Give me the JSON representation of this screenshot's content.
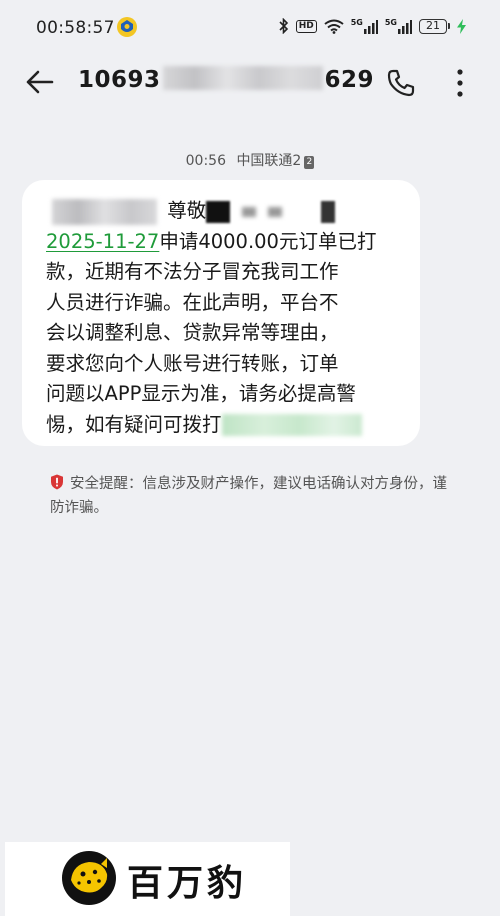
{
  "status_bar": {
    "time": "00:58:57",
    "battery_level": "21",
    "network_1": "5G",
    "network_2": "5G",
    "hd_label": "HD",
    "icons": [
      "police-badge-icon",
      "bluetooth-icon",
      "hd-voice-icon",
      "wifi-icon",
      "signal-icon",
      "battery-icon",
      "charging-icon"
    ]
  },
  "header": {
    "sender_prefix": "10693",
    "sender_suffix": "629",
    "back_icon": "back-arrow-icon",
    "call_icon": "phone-icon",
    "more_icon": "more-vertical-icon"
  },
  "message": {
    "time": "00:56",
    "carrier": "中国联通2",
    "sim_badge": "2",
    "greeting_fragment": "尊敬",
    "date_link": "2025-11-27",
    "line1_rest": "申请4000.00元订单已打",
    "line2": "款，近期有不法分子冒充我司工作",
    "line3": "人员进行诈骗。在此声明，平台不",
    "line4": "会以调整利息、贷款异常等理由，",
    "line5": "要求您向个人账号进行转账，订单",
    "line6": "问题以APP显示为准，请务必提高警",
    "line7_visible": "惕，如有疑问可拨打"
  },
  "safety_tip": {
    "text": "安全提醒：信息涉及财产操作，建议电话确认对方身份，谨防诈骗。",
    "icon": "shield-warning-icon",
    "icon_color": "#d93636"
  },
  "watermark": {
    "text": "百万豹",
    "logo_icon": "leopard-logo-icon",
    "logo_color": "#f5c400"
  },
  "colors": {
    "background": "#eff0f3",
    "bubble": "#ffffff",
    "link": "#1f9b3a"
  }
}
